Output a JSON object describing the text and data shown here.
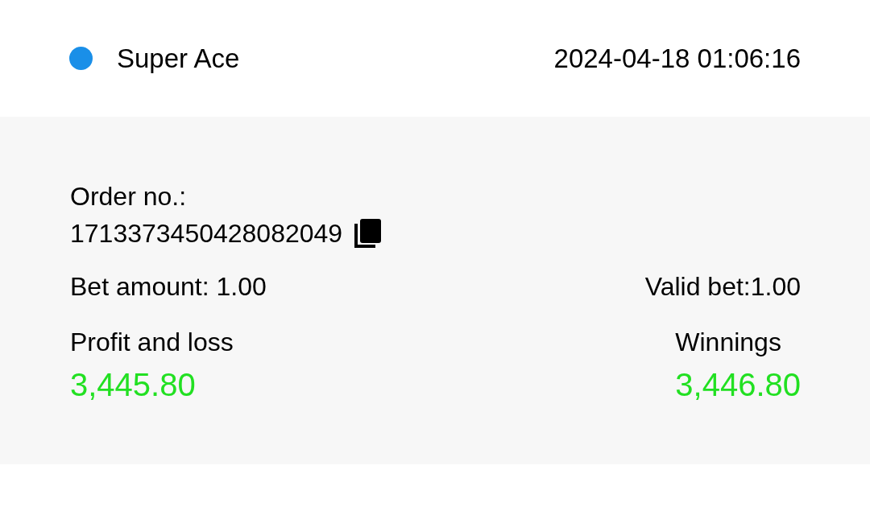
{
  "header": {
    "game": "Super Ace",
    "color": "#1a8fe8",
    "time": "2024-04-18 01:06:16"
  },
  "details": {
    "order_label": "Order no.:",
    "order_no": "1713373450428082049",
    "bet_amount": "Bet amount: 1.00",
    "valid_bet": "Valid bet:1.00",
    "profit_label": "Profit and loss",
    "profit": "3,445.80",
    "winnings_label": "Winnings",
    "winnings": "3,446.80"
  }
}
